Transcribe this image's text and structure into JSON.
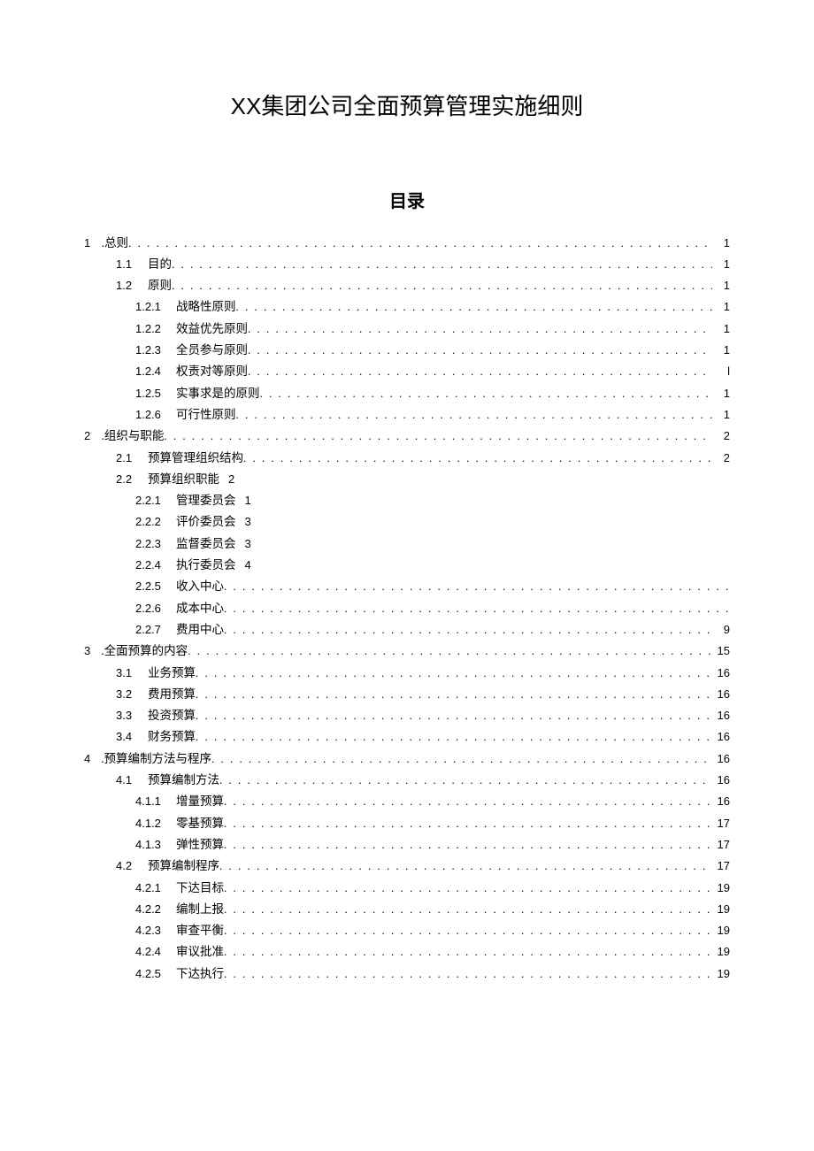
{
  "title": "XX集团公司全面预算管理实施细则",
  "toc_heading": "目录",
  "toc": [
    {
      "level": 1,
      "num": "1",
      "label": ".总则",
      "page": "1",
      "style": "dots"
    },
    {
      "level": 2,
      "num": "1.1",
      "label": "目的",
      "page": "1",
      "style": "dots"
    },
    {
      "level": 2,
      "num": "1.2",
      "label": "原则",
      "page": "1",
      "style": "dots"
    },
    {
      "level": 3,
      "num": "1.2.1",
      "label": "战略性原则",
      "page": "1",
      "style": "dots"
    },
    {
      "level": 3,
      "num": "1.2.2",
      "label": "效益优先原则",
      "page": "1",
      "style": "dots"
    },
    {
      "level": 3,
      "num": "1.2.3",
      "label": "全员参与原则",
      "page": "1",
      "style": "dots"
    },
    {
      "level": 3,
      "num": "1.2.4",
      "label": "权责对等原则",
      "page": "l",
      "style": "dots"
    },
    {
      "level": 3,
      "num": "1.2.5",
      "label": "实事求是的原则",
      "page": "1",
      "style": "dots"
    },
    {
      "level": 3,
      "num": "1.2.6",
      "label": "可行性原则",
      "page": "1",
      "style": "dots"
    },
    {
      "level": 1,
      "num": "2",
      "label": ".组织与职能",
      "page": "2",
      "style": "dots"
    },
    {
      "level": 2,
      "num": "2.1",
      "label": "预算管理组织结构",
      "page": "2",
      "style": "dots"
    },
    {
      "level": 2,
      "num": "2.2",
      "label": "预算组织职能",
      "page": "2",
      "style": "inline"
    },
    {
      "level": 3,
      "num": "2.2.1",
      "label": "管理委员会",
      "page": "1",
      "style": "inline"
    },
    {
      "level": 3,
      "num": "2.2.2",
      "label": "评价委员会",
      "page": "3",
      "style": "inline"
    },
    {
      "level": 3,
      "num": "2.2.3",
      "label": "监督委员会",
      "page": "3",
      "style": "inline"
    },
    {
      "level": 3,
      "num": "2.2.4",
      "label": "执行委员会",
      "page": "4",
      "style": "inline"
    },
    {
      "level": 3,
      "num": "2.2.5",
      "label": "收入中心",
      "page": "",
      "style": "dots-nopage"
    },
    {
      "level": 3,
      "num": "2.2.6",
      "label": "成本中心",
      "page": "",
      "style": "dots-nopage"
    },
    {
      "level": 3,
      "num": "2.2.7",
      "label": "费用中心",
      "page": "9",
      "style": "dots"
    },
    {
      "level": 1,
      "num": "3",
      "label": ".全面预算的内容",
      "page": "15",
      "style": "dots"
    },
    {
      "level": 2,
      "num": "3.1",
      "label": "业务预算",
      "page": "16",
      "style": "dots"
    },
    {
      "level": 2,
      "num": "3.2",
      "label": "费用预算",
      "page": "16",
      "style": "dots"
    },
    {
      "level": 2,
      "num": "3.3",
      "label": "投资预算",
      "page": "16",
      "style": "dots"
    },
    {
      "level": 2,
      "num": "3.4",
      "label": "财务预算",
      "page": "16",
      "style": "dots"
    },
    {
      "level": 1,
      "num": "4",
      "label": ".预算编制方法与程序",
      "page": "16",
      "style": "dots"
    },
    {
      "level": 2,
      "num": "4.1",
      "label": "预算编制方法",
      "page": "16",
      "style": "dots"
    },
    {
      "level": 3,
      "num": "4.1.1",
      "label": "增量预算",
      "page": "16",
      "style": "dots"
    },
    {
      "level": 3,
      "num": "4.1.2",
      "label": "零基预算",
      "page": "17",
      "style": "dots"
    },
    {
      "level": 3,
      "num": "4.1.3",
      "label": "弹性预算",
      "page": "17",
      "style": "dots"
    },
    {
      "level": 2,
      "num": "4.2",
      "label": "预算编制程序",
      "page": "17",
      "style": "dots"
    },
    {
      "level": 3,
      "num": "4.2.1",
      "label": "下达目标",
      "page": "19",
      "style": "dots"
    },
    {
      "level": 3,
      "num": "4.2.2",
      "label": "编制上报",
      "page": "19",
      "style": "dots"
    },
    {
      "level": 3,
      "num": "4.2.3",
      "label": "审查平衡",
      "page": "19",
      "style": "dots"
    },
    {
      "level": 3,
      "num": "4.2.4",
      "label": "审议批准",
      "page": "19",
      "style": "dots"
    },
    {
      "level": 3,
      "num": "4.2.5",
      "label": "下达执行",
      "page": "19",
      "style": "dots"
    }
  ]
}
